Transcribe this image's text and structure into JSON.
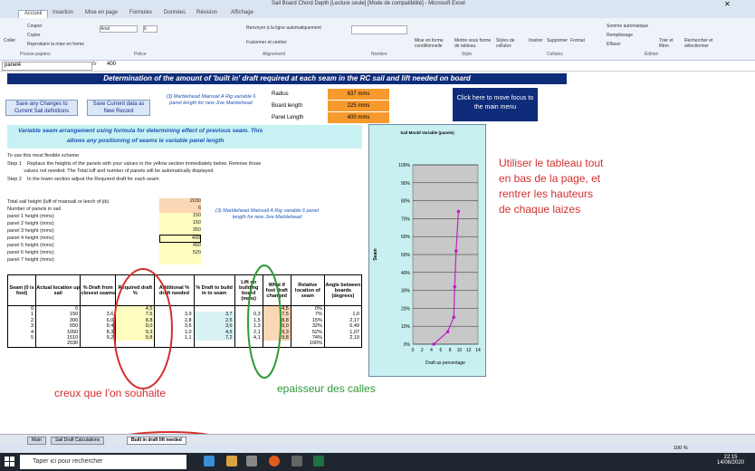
{
  "window": {
    "title": "Sail Board Chord Depth [Lecture seule] [Mode de compatibilité] - Microsoft Excel"
  },
  "ribbon_tabs": [
    "Accueil",
    "Insertion",
    "Mise en page",
    "Formules",
    "Données",
    "Révision",
    "Affichage"
  ],
  "ribbon": {
    "paste": "Coller",
    "cut": "Couper",
    "copy": "Copier",
    "format_painter": "Reproduire la mise en forme",
    "font_name": "Arial",
    "font_size": "6",
    "wrap": "Renvoyer à la ligne automatiquement",
    "merge": "Fusionner et centrer",
    "cond_format": "Mise en forme conditionnelle",
    "table_format": "Mettre sous forme de tableau",
    "styles_cells": "Styles de cellules",
    "insert": "Insérer",
    "delete": "Supprimer",
    "format": "Format",
    "autosum": "Somme automatique",
    "fill": "Remplissage",
    "clear": "Effacer",
    "sort": "Trier et filtrer",
    "find": "Rechercher et sélectionner",
    "groups": [
      "Presse-papiers",
      "Police",
      "Alignement",
      "Nombre",
      "Style",
      "Cellules",
      "Édition"
    ]
  },
  "formula_bar": {
    "name_box": "panel4",
    "fx": "fx",
    "value": "400"
  },
  "sheet": {
    "banner": "Determination of the amount of 'built in' draft required at each seam in the RC sail and lift needed on board",
    "buttons": {
      "save_changes": "Save any Changes to Current Sail definitions",
      "save_current": "Save Current data as New Record",
      "move_focus": "Click here to move focus to the main menu"
    },
    "note1": "(3) Marblehead Mainsail A Rig variable 6 panel length for new Jive Marblehead",
    "fields": [
      {
        "label": "Radius",
        "value": "637 mms"
      },
      {
        "label": "Board length",
        "value": "225 mms"
      },
      {
        "label": "Panel Length",
        "value": "400 mms"
      }
    ],
    "variable_header_1": "Variable seam arrangement using formula for determining effect of previous seam. This",
    "variable_header_2": "allows any positioning of seams ie variable panel length",
    "instructions": [
      "To use this most flexible scheme",
      "Step 1    Replace the heights of the panels with your values in the yellow section immediately below. Remove those",
      "            values not needed. The Total luff and number of panels will be automatically displayed",
      "Step 2    In the lower section adjust the Required draft for each seam"
    ],
    "inputs": [
      {
        "label": "Total sail height (luff of mainsail or leech of jib)",
        "value": "2030"
      },
      {
        "label": "Number of panels in sail",
        "value": "6"
      },
      {
        "label": "panel 1 height (mms)",
        "value": "150"
      },
      {
        "label": "panel 2 height (mms)",
        "value": "150"
      },
      {
        "label": "panel 3 height (mms)",
        "value": "350"
      },
      {
        "label": "panel 4 height (mms)",
        "value": "400"
      },
      {
        "label": "panel 5 height (mms)",
        "value": "460"
      },
      {
        "label": "panel 6 height (mms)",
        "value": "520"
      },
      {
        "label": "panel 7 height (mms)",
        "value": ""
      }
    ],
    "note2": "(3) Marblehead Mainsail A Rig variable 6 panel length for new Jive Marblehead",
    "table": {
      "headers": [
        "Seam (0 is foot)",
        "Actual location up sail",
        "% Draft from closest seams",
        "Required draft %",
        "Additional % draft needed",
        "% Draft to build in to seam",
        "Lift on building board (mms)",
        "What if foot draft changed",
        "Relative location of seam",
        "Angle between boards (degrees)"
      ],
      "rows": [
        [
          "0",
          "0",
          "",
          "4,5",
          "",
          "",
          "",
          "4,5",
          "0%",
          ""
        ],
        [
          "1",
          "150",
          "3,6",
          "7,5",
          "3,9",
          "3,7",
          "0,3",
          "7,5",
          "7%",
          "1,0"
        ],
        [
          "2",
          "300",
          "6,0",
          "8,8",
          "2,8",
          "2,5",
          "1,5",
          "8,8",
          "15%",
          "2,17"
        ],
        [
          "3",
          "650",
          "9,4",
          "9,0",
          "3,6",
          "3,6",
          "1,3",
          "9,0",
          "32%",
          "0,49"
        ],
        [
          "4",
          "1050",
          "8,3",
          "9,3",
          "1,0",
          "4,6",
          "2,1",
          "9,3",
          "52%",
          "1,07"
        ],
        [
          "5",
          "1510",
          "9,2",
          "9,8",
          "1,1",
          "7,2",
          "4,1",
          "9,8",
          "74%",
          "2,19"
        ],
        [
          "",
          "2030",
          "",
          "",
          "",
          "",
          "",
          "",
          "100%",
          ""
        ]
      ]
    }
  },
  "chart_data": {
    "type": "line",
    "title": "Sail Mould Variable (panels)",
    "xlabel": "Draft as percentage",
    "ylabel": "Seam",
    "x_ticks": [
      "0",
      "2",
      "4",
      "6",
      "8",
      "10",
      "12",
      "14"
    ],
    "y_ticks": [
      "0%",
      "10%",
      "20%",
      "30%",
      "40%",
      "50%",
      "60%",
      "70%",
      "80%",
      "90%",
      "100%"
    ],
    "xlim": [
      0,
      14
    ],
    "ylim": [
      0,
      100
    ],
    "series": [
      {
        "x": [
          4.5,
          7.5,
          8.8,
          9.0,
          9.3,
          9.8
        ],
        "y": [
          0,
          7,
          15,
          32,
          52,
          74
        ]
      }
    ],
    "color": "#c020c0"
  },
  "annotations": {
    "right_lines": [
      "Utiliser le tableau tout",
      "en bas de la page, et",
      "rentrer les hauteurs",
      "de chaque laizes"
    ],
    "bottom_left": "creux que l'on souhaite",
    "bottom_mid": "epaisseur des calles"
  },
  "sheet_tabs": [
    "Main",
    "Sail Draft Calculations",
    "Built in draft lift needed"
  ],
  "status": {
    "zoom": "100 %"
  },
  "taskbar": {
    "search": "Taper ici pour rechercher",
    "time": "22:15",
    "date": "14/06/2020"
  }
}
